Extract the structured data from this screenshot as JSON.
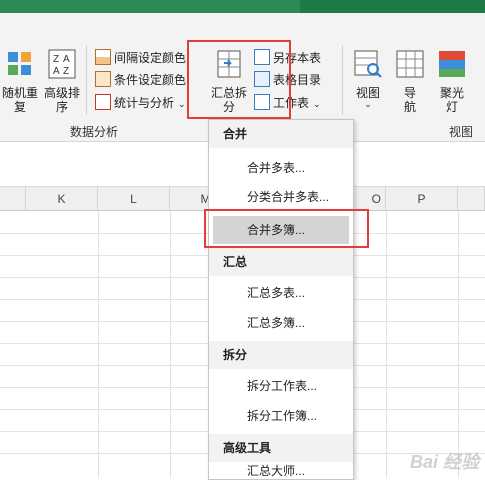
{
  "ribbon": {
    "buttons": {
      "random_repeat": "随机重\n复",
      "advanced_sort": "高级排\n序",
      "summarize_split": "汇总拆\n分",
      "view": "视图",
      "navigate": "导\n航",
      "spotlight": "聚光\n灯"
    },
    "small_buttons": {
      "interval_color": "间隔设定颜色",
      "condition_color": "条件设定颜色",
      "stats_analysis": "统计与分析",
      "save_sheet": "另存本表",
      "sheet_catalog": "表格目录",
      "worksheet": "工作表"
    },
    "group_labels": {
      "data_analysis": "数据分析",
      "view_group": "视图"
    }
  },
  "columns": [
    "K",
    "L",
    "M",
    "O",
    "P"
  ],
  "menu": {
    "sections": [
      {
        "title": "合并",
        "items": [
          "合并多表...",
          "分类合并多表...",
          "合并多簿..."
        ]
      },
      {
        "title": "汇总",
        "items": [
          "汇总多表...",
          "汇总多簿..."
        ]
      },
      {
        "title": "拆分",
        "items": [
          "拆分工作表...",
          "拆分工作簿..."
        ]
      },
      {
        "title": "高级工具",
        "items": [
          "汇总大师..."
        ]
      }
    ]
  },
  "highlight_color": "#e53b3b",
  "watermark": "Bai 经验"
}
